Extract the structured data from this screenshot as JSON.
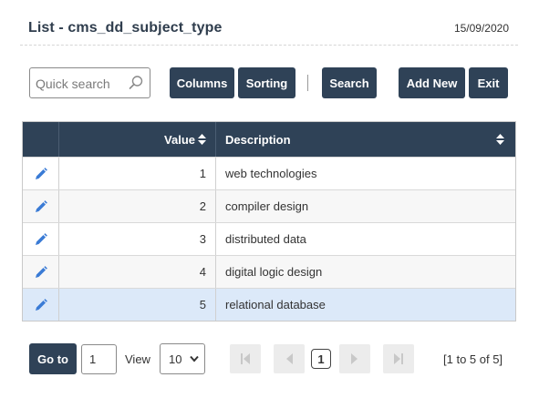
{
  "header": {
    "title": "List - cms_dd_subject_type",
    "date": "15/09/2020"
  },
  "toolbar": {
    "search_placeholder": "Quick search",
    "columns_label": "Columns",
    "sorting_label": "Sorting",
    "search_label": "Search",
    "add_new_label": "Add New",
    "exit_label": "Exit"
  },
  "grid": {
    "columns": [
      "Value",
      "Description"
    ],
    "rows": [
      {
        "value": "1",
        "description": "web technologies"
      },
      {
        "value": "2",
        "description": "compiler design"
      },
      {
        "value": "3",
        "description": "distributed data"
      },
      {
        "value": "4",
        "description": "digital logic design"
      },
      {
        "value": "5",
        "description": "relational database"
      }
    ],
    "selected_row": 5
  },
  "pager": {
    "goto_label": "Go to",
    "goto_value": "1",
    "view_label": "View",
    "view_value": "10",
    "current_page": "1",
    "info": "[1 to 5 of 5]"
  },
  "colors": {
    "primary": "#2f4257",
    "selected_row": "#dce9f9",
    "edit_icon": "#3a7bd5"
  },
  "icons": [
    "search-icon",
    "sort-icon",
    "edit-pencil-icon",
    "first-page-icon",
    "prev-page-icon",
    "next-page-icon",
    "last-page-icon",
    "chevron-down-icon"
  ]
}
